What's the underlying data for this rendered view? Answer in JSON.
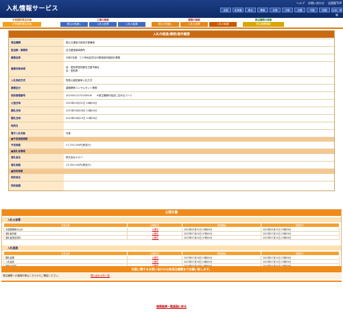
{
  "header": {
    "title": "入札情報サービス",
    "top_links": [
      "ヘルプ",
      "お問い合わせ",
      "全国版TOP"
    ],
    "regions": [
      "北海道",
      "東北",
      "関東",
      "北陸",
      "中部",
      "近畿",
      "中国",
      "四国",
      "九州・沖縄"
    ],
    "region_first": "全国"
  },
  "nav": {
    "groups": [
      {
        "title": "中長期的発注計画",
        "tabs": [
          "中長期的発注計画"
        ]
      },
      {
        "title": "工事の検索",
        "tabs": [
          "発注の見通し",
          "入札公告等",
          "入札の結果"
        ]
      },
      {
        "title": "業務の検索",
        "tabs": [
          "発注の見通し",
          "入札公告等",
          "入札の結果"
        ]
      },
      {
        "title": "発注機関の検索",
        "tabs": [
          "発注機関情報"
        ]
      }
    ]
  },
  "detail": {
    "heading": "入札の経過(業務)案件概要",
    "rows": [
      {
        "label": "発注機関",
        "value": "国土交通省中部地方整備局"
      },
      {
        "label": "担当部・事務所",
        "value": "名古屋国道事務所"
      },
      {
        "label": "業務名称",
        "value": "令和5年度　三ケ所地区防災対策施設詳細設計業務"
      },
      {
        "label": "業務対象地域",
        "value": "自：愛知県愛知郡名古屋市東区\n至：愛知県"
      },
      {
        "label": "入札契約方式",
        "value": "簡易公募型競争入札方式"
      },
      {
        "label": "業務区分",
        "value": "建築関係コンサルタント業務"
      },
      {
        "label": "契約管理番号",
        "value": "20230512270200006　　※発注機関が独自に定めるコード"
      },
      {
        "label": "公告日時",
        "value": "2023年05月31日 16時00分"
      },
      {
        "label": "開札日時",
        "value": "2023年06月28日 10時00分"
      },
      {
        "label": "開札日時",
        "value": "2023年06月23日 11時00分"
      },
      {
        "label": "契約日",
        "value": ""
      },
      {
        "label": "電子入札対象",
        "value": "対象"
      }
    ],
    "section_estimate": "■予定価格情報",
    "estimate_rows": [
      {
        "label": "予定価格",
        "value": "17,370,000円(税抜き)"
      }
    ],
    "section_winner": "■落札者情報",
    "winner_rows": [
      {
        "label": "落札者名",
        "value": "株式会社オオバ"
      },
      {
        "label": "落札価格",
        "value": "13,500,000円(税抜き)"
      }
    ],
    "section_contract": "■契約情報",
    "contract_rows": [
      {
        "label": "契約者名",
        "value": ""
      },
      {
        "label": "契約金額",
        "value": ""
      }
    ]
  },
  "docs": {
    "heading": "公開文書",
    "columns": [
      "文書名称",
      "公開状況",
      "掲載開始",
      "掲載終了"
    ],
    "sections": [
      {
        "title": "入札公告等",
        "rows": [
          [
            "中部整備局の公示",
            "公開中",
            "2023年05月31日 16時00分",
            "2023年05月31日 23時59分"
          ],
          [
            "落札者情報",
            "公開中",
            "2023年07月04日 07時00分",
            "2023年07月31日 23時59分"
          ],
          [
            "落札者選定資料",
            "公開中",
            "2023年07月04日 07時00分",
            "2023年07月31日 23時59分"
          ]
        ]
      },
      {
        "title": "入札経過",
        "rows": [
          [
            "開札結果",
            "公開中",
            "2023年07月18日 16時00分",
            "2023年07月31日 23時59分"
          ],
          [
            "入札経過",
            "公開中",
            "2023年07月18日 16時00分",
            "2023年07月31日 23時59分"
          ],
          [
            "契約の内容",
            "公開中",
            "2023年07月18日 16時00分",
            "2023年07月31日 23時59分"
          ]
        ]
      }
    ]
  },
  "contact": {
    "heading": "内容に関するお問い合わせは各発注機関までお願い致します。",
    "label": "発注機関への連絡先等はこちらからご確認ください。",
    "link": "問い合わせ先一覧"
  },
  "back_link": "検索結果一覧画面に戻る",
  "colors": {
    "header_bg": "#1d3f86",
    "accent_orange": "#f08a1a",
    "label_bg": "#fde8c8"
  }
}
